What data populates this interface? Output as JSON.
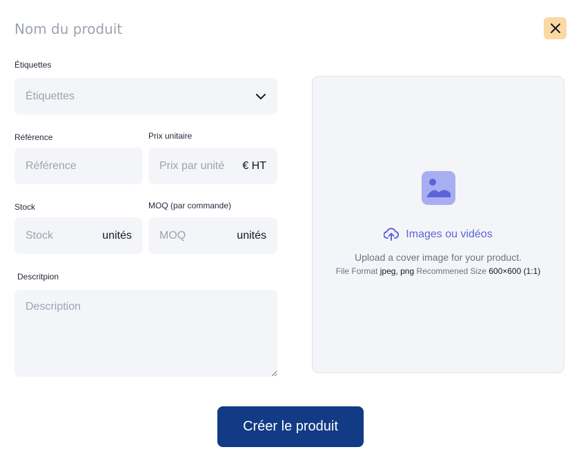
{
  "header": {
    "title_placeholder": "Nom du produit",
    "close_icon": "close-icon"
  },
  "form": {
    "tags": {
      "label": "Étiquettes",
      "placeholder": "Étiquettes",
      "icon": "chevron-down-icon"
    },
    "reference": {
      "label": "Référence",
      "placeholder": "Référence"
    },
    "unit_price": {
      "label": "Prix unitaire",
      "placeholder": "Prix par unité",
      "suffix": "€ HT"
    },
    "stock": {
      "label": "Stock",
      "placeholder": "Stock",
      "suffix": "unités"
    },
    "moq": {
      "label": "MOQ (par commande)",
      "placeholder": "MOQ",
      "suffix": "unités"
    },
    "description": {
      "label": "Descritpion",
      "placeholder": "Description"
    }
  },
  "upload": {
    "image_icon": "image-icon",
    "upload_icon": "cloud-upload-icon",
    "cta": "Images ou vidéos",
    "hint": "Upload a cover image for your product.",
    "format_label": "File Format",
    "format_value": "jpeg, png",
    "size_label": "Recommened Size",
    "size_value": "600×600 (1:1)"
  },
  "actions": {
    "submit_label": "Créer le produit"
  },
  "colors": {
    "field_bg": "#f4f5f9",
    "close_bg": "#fbd9a3",
    "accent": "#5b63d9",
    "primary_button": "#133a84"
  }
}
